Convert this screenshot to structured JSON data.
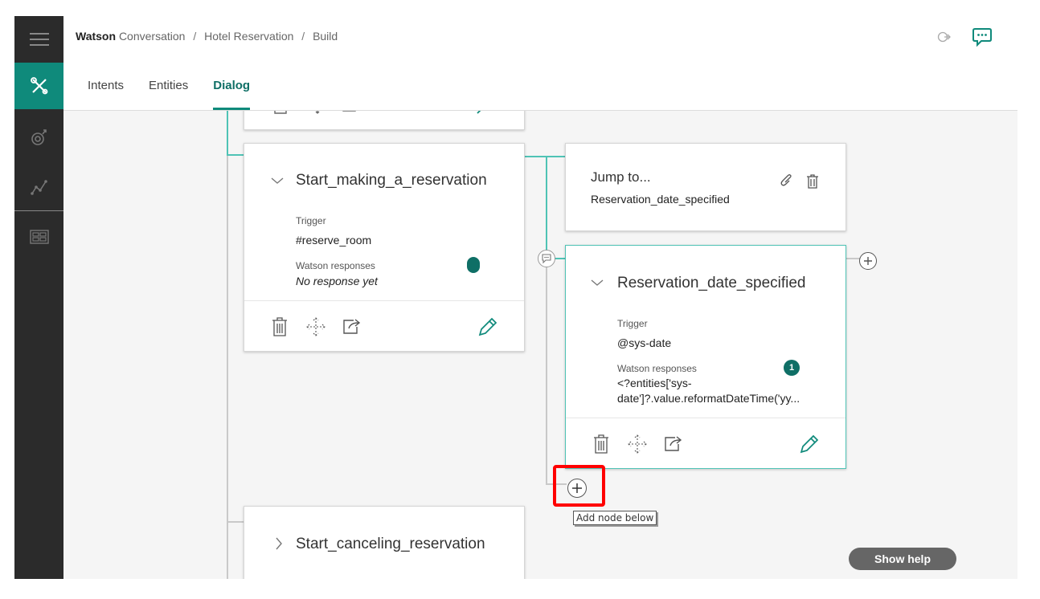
{
  "header": {
    "breadcrumb": {
      "brand": "Watson",
      "product": "Conversation",
      "workspace": "Hotel Reservation",
      "page": "Build",
      "separator": "/"
    }
  },
  "tabs": [
    {
      "label": "Intents",
      "active": false
    },
    {
      "label": "Entities",
      "active": false
    },
    {
      "label": "Dialog",
      "active": true
    }
  ],
  "left_nav": [
    "menu-icon",
    "build-tools-icon",
    "improve-icon",
    "analytics-icon",
    "workspaces-icon"
  ],
  "nodes": {
    "start_making": {
      "title": "Start_making_a_reservation",
      "trigger_label": "Trigger",
      "trigger": "#reserve_room",
      "responses_label": "Watson responses",
      "responses": "No response yet"
    },
    "jump_to": {
      "title": "Jump to...",
      "target": "Reservation_date_specified"
    },
    "reservation_date": {
      "title": "Reservation_date_specified",
      "trigger_label": "Trigger",
      "trigger": "@sys-date",
      "responses_label": "Watson responses",
      "response_count": "1",
      "response_line1": "<?entities['sys-",
      "response_line2": "date']?.value.reformatDateTime('yy..."
    },
    "start_canceling": {
      "title": "Start_canceling_reservation"
    }
  },
  "tooltip": "Add node below",
  "show_help": "Show help",
  "colors": {
    "accent": "#0f8a7b",
    "highlight": "#ff0000",
    "nav_bg": "#2b2b2b"
  }
}
